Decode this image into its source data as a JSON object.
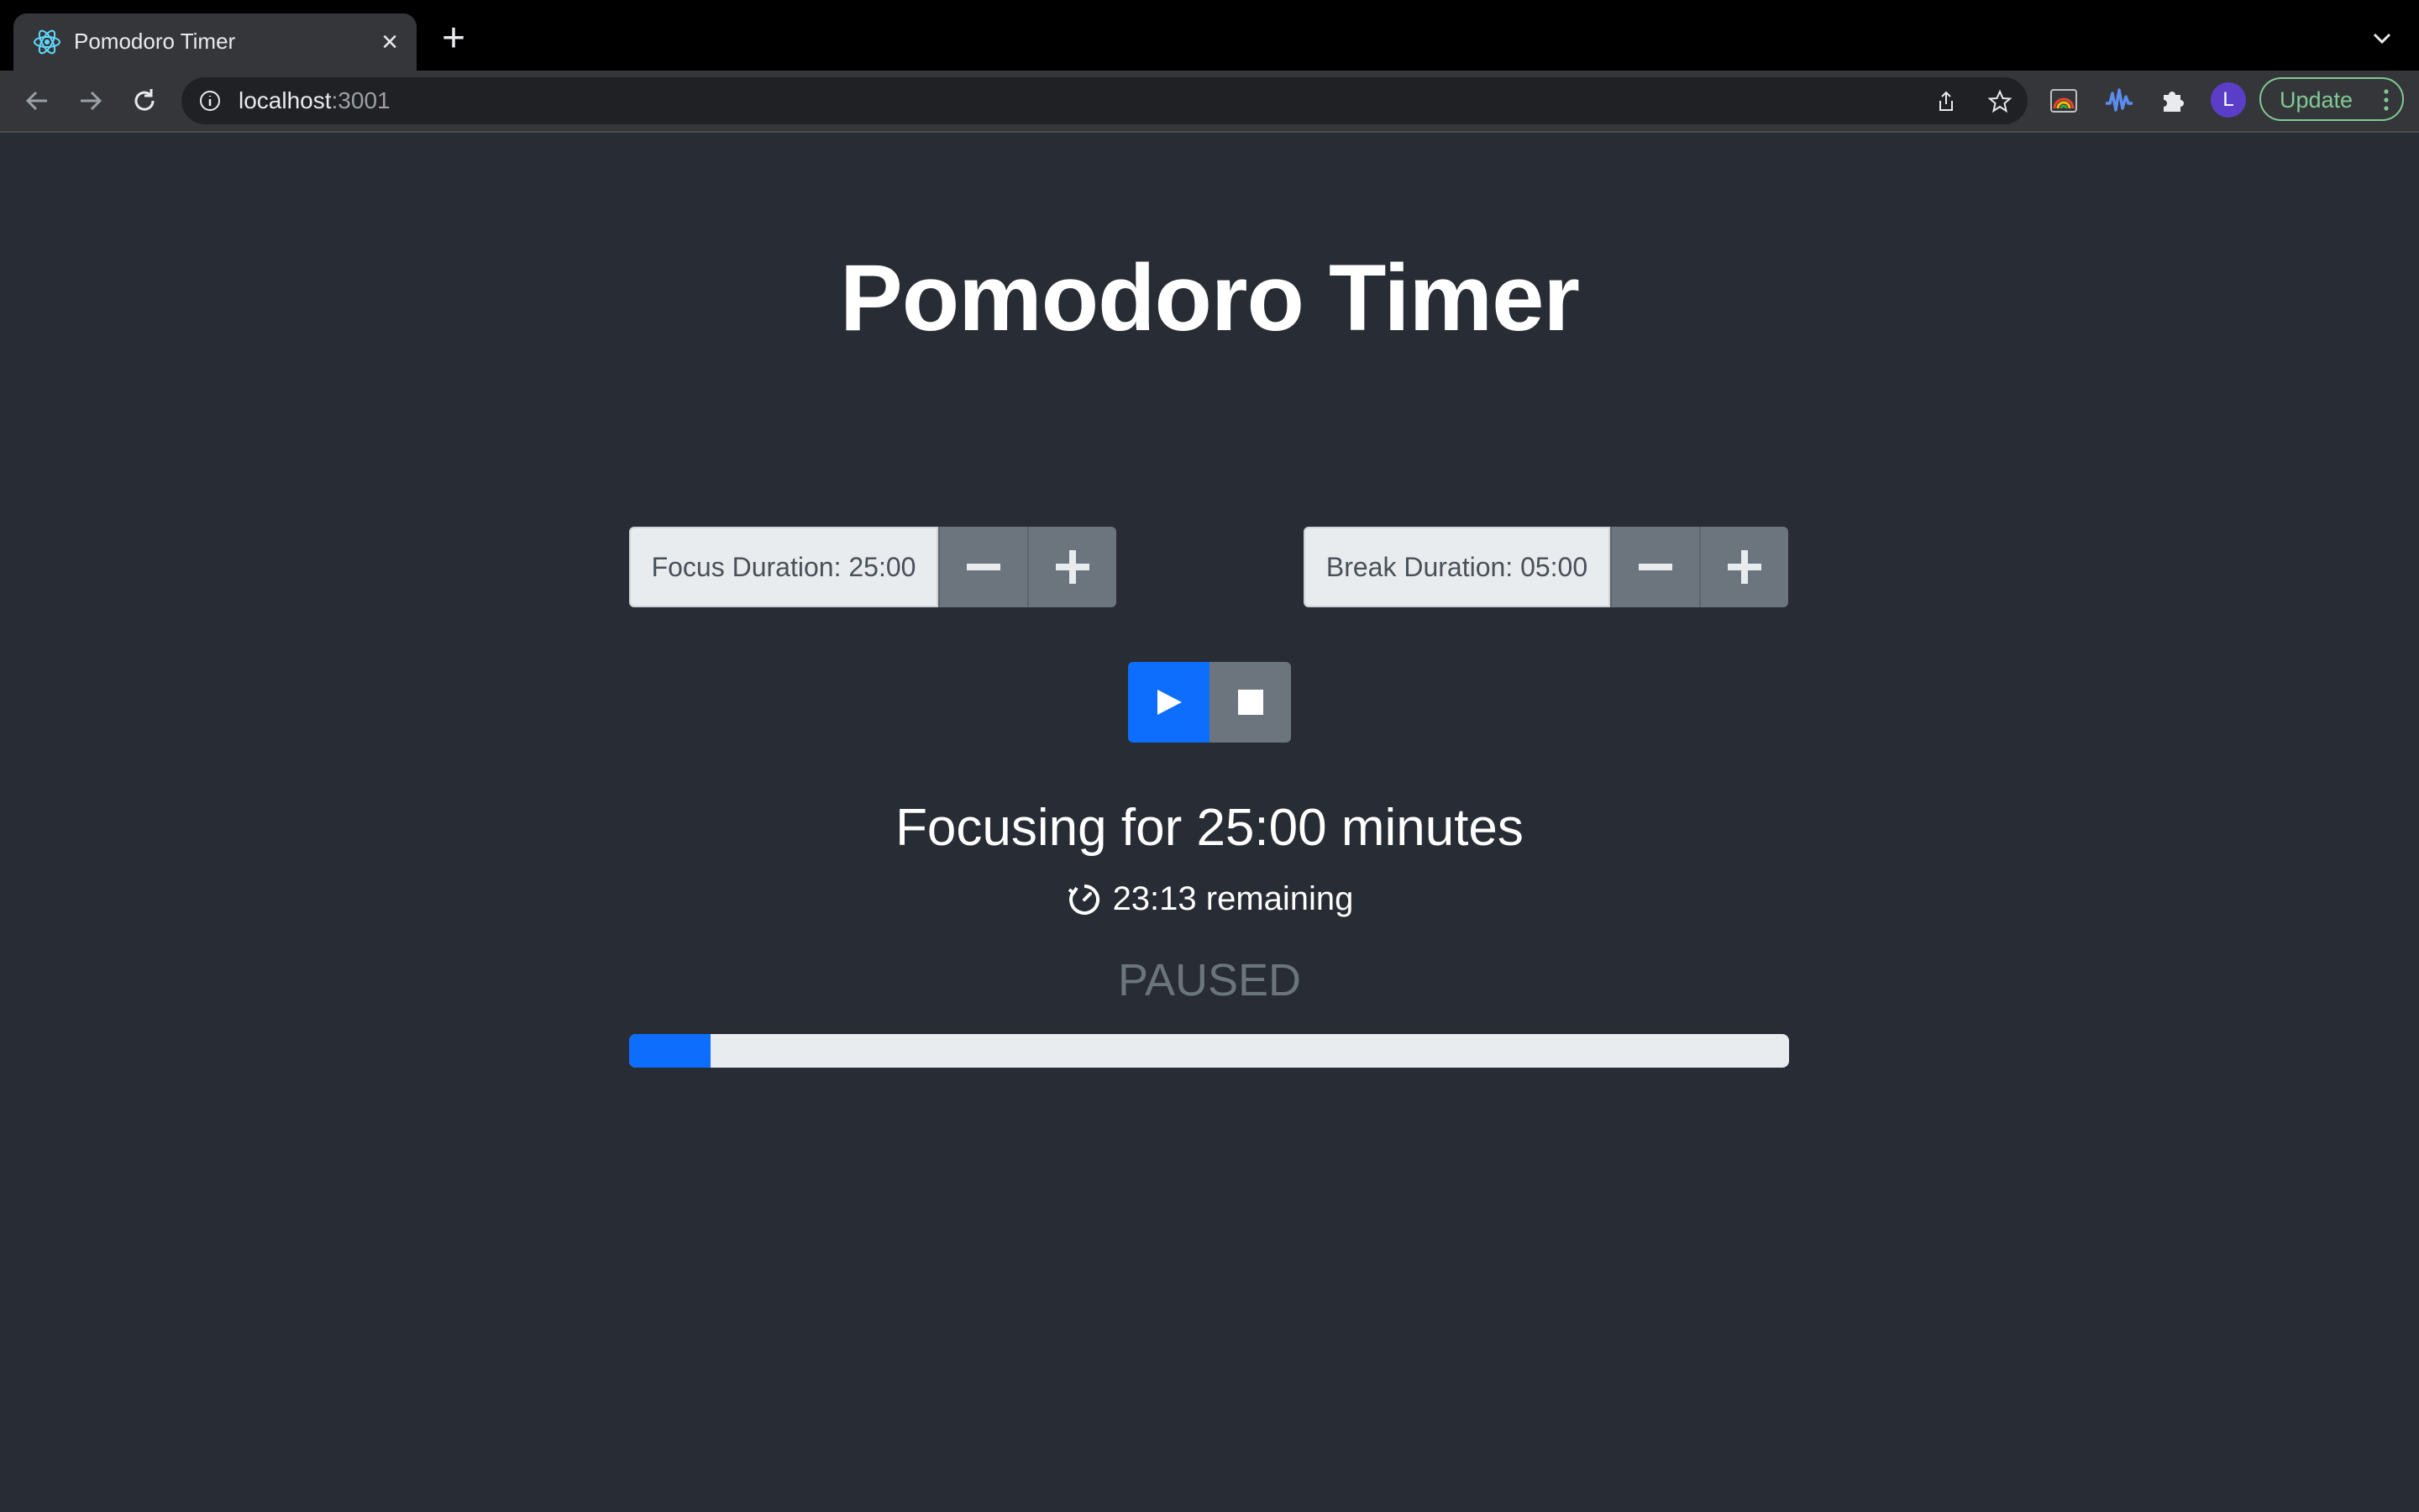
{
  "browser": {
    "tab_title": "Pomodoro Timer",
    "url_host": "localhost",
    "url_port": ":3001",
    "profile_initial": "L",
    "update_label": "Update"
  },
  "page": {
    "title": "Pomodoro Timer",
    "focus_duration_label": "Focus Duration: 25:00",
    "break_duration_label": "Break Duration: 05:00",
    "status_heading": "Focusing for 25:00 minutes",
    "remaining_text": "23:13 remaining",
    "state_text": "PAUSED",
    "progress_percent": 7
  },
  "icons": {
    "tab": "react-icon",
    "play": "play-icon",
    "stop": "stop-icon",
    "decrease": "minus-icon",
    "increase": "plus-icon",
    "timer": "timer-icon"
  },
  "colors": {
    "background": "#282c34",
    "primary": "#0d6efd",
    "secondary": "#6c757d",
    "update_accent": "#81c995"
  }
}
